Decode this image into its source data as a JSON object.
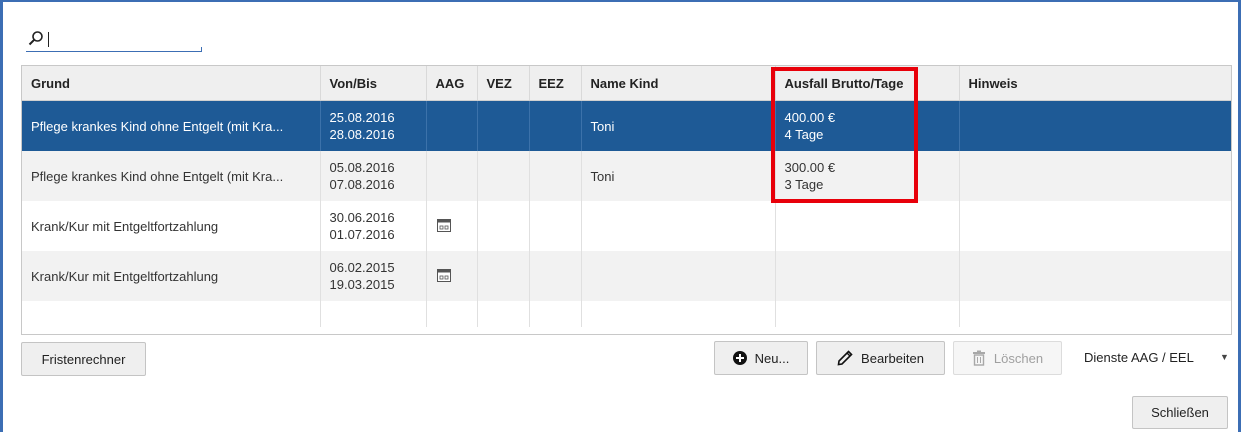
{
  "search": {
    "value": ""
  },
  "table": {
    "columns": [
      "Grund",
      "Von/Bis",
      "AAG",
      "VEZ",
      "EEZ",
      "Name Kind",
      "Ausfall Brutto/Tage",
      "Hinweis"
    ],
    "rows": [
      {
        "grund": "Pflege krankes Kind ohne Entgelt (mit Kra...",
        "von": "25.08.2016",
        "bis": "28.08.2016",
        "aag_icon": "",
        "name_kind": "Toni",
        "ausfall_betrag": "400.00 €",
        "ausfall_tage": "4 Tage",
        "selected": true
      },
      {
        "grund": "Pflege krankes Kind ohne Entgelt (mit Kra...",
        "von": "05.08.2016",
        "bis": "07.08.2016",
        "aag_icon": "",
        "name_kind": "Toni",
        "ausfall_betrag": "300.00 €",
        "ausfall_tage": "3 Tage",
        "selected": false
      },
      {
        "grund": "Krank/Kur mit Entgeltfortzahlung",
        "von": "30.06.2016",
        "bis": "01.07.2016",
        "aag_icon": "calendar-icon",
        "name_kind": "",
        "ausfall_betrag": "",
        "ausfall_tage": "",
        "selected": false
      },
      {
        "grund": "Krank/Kur mit Entgeltfortzahlung",
        "von": "06.02.2015",
        "bis": "19.03.2015",
        "aag_icon": "calendar-icon",
        "name_kind": "",
        "ausfall_betrag": "",
        "ausfall_tage": "",
        "selected": false
      }
    ]
  },
  "buttons": {
    "fristenrechner": "Fristenrechner",
    "neu": "Neu...",
    "bearbeiten": "Bearbeiten",
    "loeschen": "Löschen",
    "dienste": "Dienste AAG / EEL",
    "schliessen": "Schließen"
  },
  "colors": {
    "selection": "#1e5a96",
    "highlight": "#e8000a",
    "frame": "#3c6eb4"
  }
}
